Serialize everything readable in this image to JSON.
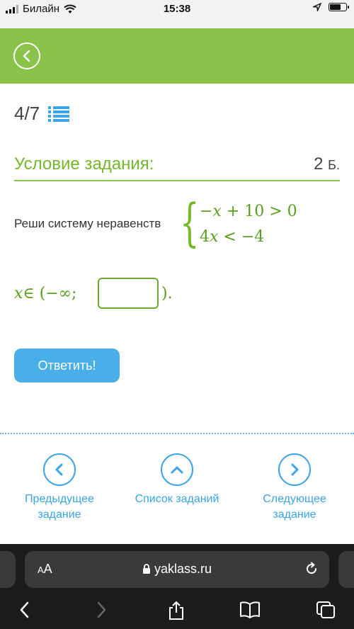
{
  "status_bar": {
    "carrier": "Билайн",
    "time": "15:38"
  },
  "progress": {
    "count": "4/7"
  },
  "condition": {
    "title": "Условие задания:",
    "points_value": "2",
    "points_unit": "Б."
  },
  "task": {
    "text": "Реши систему неравенств",
    "eq1_var": "−x",
    "eq1_rest": " + 10 > 0",
    "eq2_coef": "4",
    "eq2_var": "x",
    "eq2_rest": " < −4",
    "answer_var": "x",
    "answer_prefix": " ∈ (−∞;",
    "answer_suffix": ").",
    "answer_value": ""
  },
  "submit": {
    "label": "Ответить!"
  },
  "nav": {
    "prev_line1": "Предыдущее",
    "prev_line2": "задание",
    "list": "Список заданий",
    "next_line1": "Следующее",
    "next_line2": "задание"
  },
  "browser": {
    "text_size": "AA",
    "url": "yaklass.ru"
  },
  "colors": {
    "green": "#8bc34a",
    "blue": "#3aa5e8",
    "button": "#4aaee8"
  }
}
